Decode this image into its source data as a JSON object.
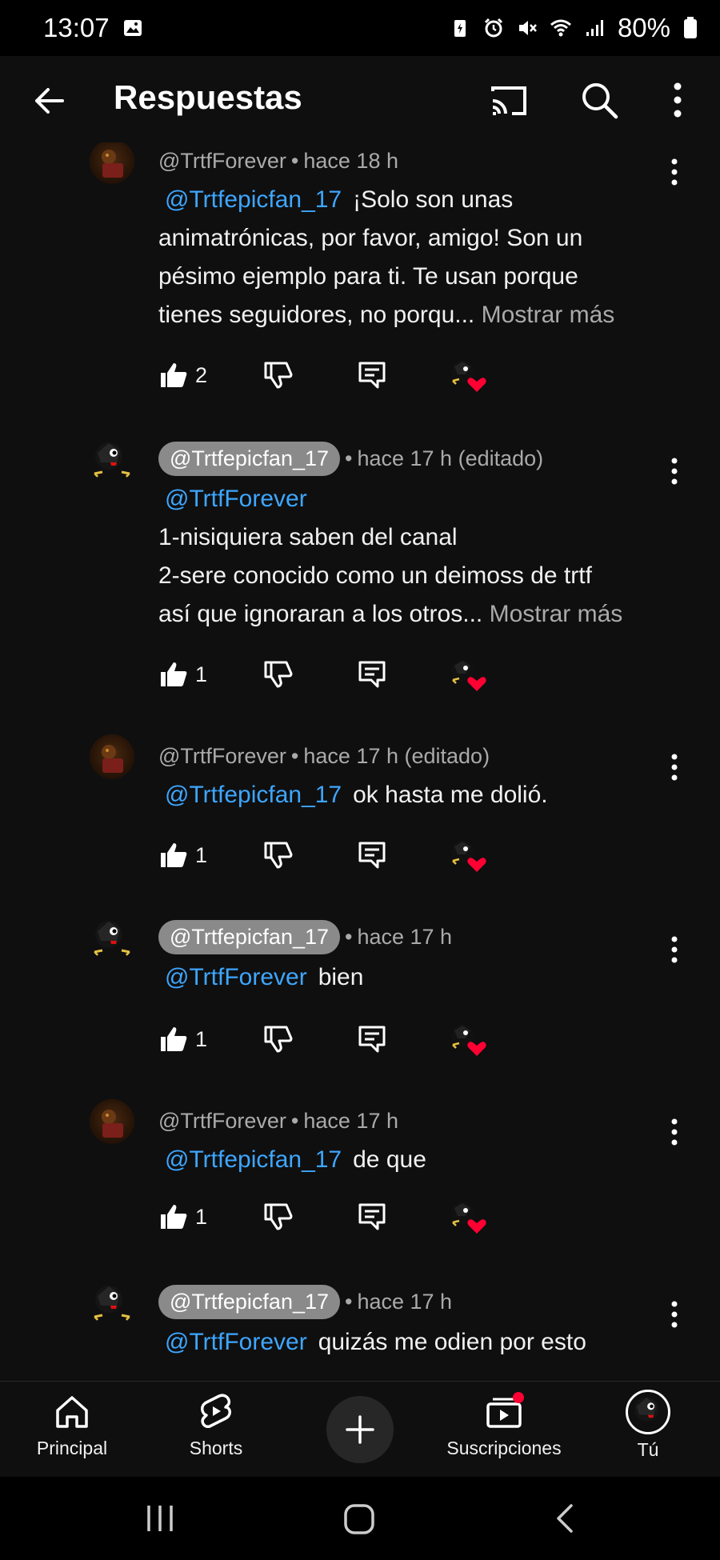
{
  "status": {
    "time": "13:07",
    "battery": "80%"
  },
  "header": {
    "title": "Respuestas"
  },
  "replies": [
    {
      "handle": "@TrtfForever",
      "time": "hace 18 h",
      "edited": "",
      "mention": "@Trtfepicfan_17",
      "text_lines": [
        "¡Solo son unas",
        "animatrónicas, por favor, amigo! Son un",
        "pésimo ejemplo para ti. Te usan porque",
        "tienes seguidores, no porqu..."
      ],
      "more": "Mostrar más",
      "likes": "2"
    },
    {
      "handle": "@Trtfepicfan_17",
      "time": "hace 17 h",
      "edited": "(editado)",
      "mention": "@TrtfForever",
      "text_lines": [
        "1-nisiquiera saben del canal",
        "2-sere conocido como un deimoss de trtf",
        "así que ignoraran a los otros..."
      ],
      "more": "Mostrar más",
      "likes": "1"
    },
    {
      "handle": "@TrtfForever",
      "time": "hace 17 h",
      "edited": "(editado)",
      "mention": "@Trtfepicfan_17",
      "text_lines": [
        "ok hasta me dolió."
      ],
      "more": "",
      "likes": "1"
    },
    {
      "handle": "@Trtfepicfan_17",
      "time": "hace 17 h",
      "edited": "",
      "mention": "@TrtfForever",
      "text_lines": [
        "bien"
      ],
      "more": "",
      "likes": "1"
    },
    {
      "handle": "@TrtfForever",
      "time": "hace 17 h",
      "edited": "",
      "mention": "@Trtfepicfan_17",
      "text_lines": [
        "de que"
      ],
      "more": "",
      "likes": "1"
    },
    {
      "handle": "@Trtfepicfan_17",
      "time": "hace 17 h",
      "edited": "",
      "mention": "@TrtfForever",
      "text_lines": [
        "quizás me odien por esto"
      ],
      "more": "",
      "likes": ""
    }
  ],
  "nav": {
    "home": "Principal",
    "shorts": "Shorts",
    "subs": "Suscripciones",
    "you": "Tú"
  },
  "colors": {
    "background": "#0f0f0f",
    "mention": "#3ea6ff",
    "secondary_text": "#aaaaaa",
    "heart": "#ff0033"
  }
}
